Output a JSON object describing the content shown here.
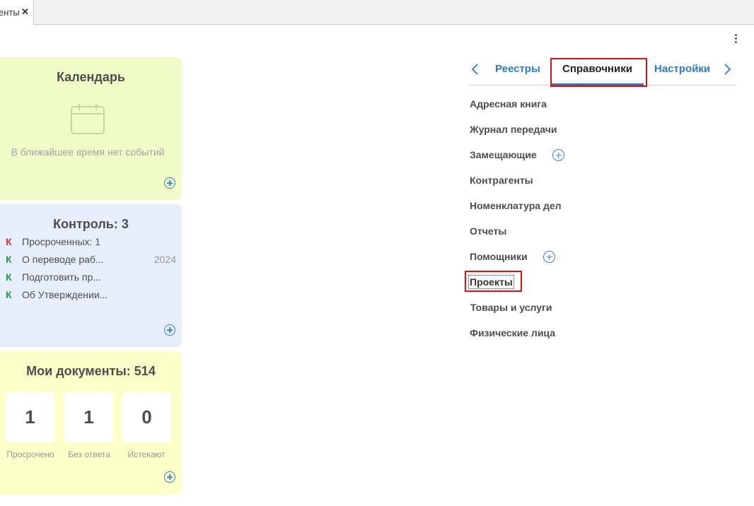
{
  "tabbar": {
    "doc_tab_label": "енты",
    "close_glyph": "✕"
  },
  "menu": {
    "icon": "kebab-menu-icon"
  },
  "calendar": {
    "title": "Календарь",
    "empty_text": "В ближайшее время нет событий",
    "icon": "calendar-icon"
  },
  "control": {
    "title": "Контроль: 3",
    "items": [
      {
        "marker": "К",
        "marker_color": "#d83a3a",
        "text": "Просроченных: 1",
        "date": ""
      },
      {
        "marker": "К",
        "marker_color": "#2a9e3f",
        "text": "О переводе раб...",
        "date": "2024"
      },
      {
        "marker": "К",
        "marker_color": "#2a9e3f",
        "text": "Подготовить пр...",
        "date": ""
      },
      {
        "marker": "К",
        "marker_color": "#2a9e3f",
        "text": "Об Утверждении...",
        "date": ""
      }
    ]
  },
  "my_docs": {
    "title": "Мои документы: 514",
    "counters": [
      {
        "value": "1",
        "label": "Просрочено"
      },
      {
        "value": "1",
        "label": "Без ответа"
      },
      {
        "value": "0",
        "label": "Истекают"
      }
    ]
  },
  "right_tabs": {
    "tabs": [
      {
        "label": "Реестры",
        "active": false
      },
      {
        "label": "Справочники",
        "active": true
      },
      {
        "label": "Настройки",
        "active": false
      }
    ],
    "prev_icon": "chevron-left-icon",
    "next_icon": "chevron-right-icon"
  },
  "references": {
    "items": [
      {
        "label": "Адресная книга",
        "has_add": false
      },
      {
        "label": "Журнал передачи",
        "has_add": false
      },
      {
        "label": "Замещающие",
        "has_add": true
      },
      {
        "label": "Контрагенты",
        "has_add": false
      },
      {
        "label": "Номенклатура дел",
        "has_add": false
      },
      {
        "label": "Отчеты",
        "has_add": false
      },
      {
        "label": "Помощники",
        "has_add": true
      },
      {
        "label": "Проекты",
        "has_add": false
      },
      {
        "label": "Товары и услуги",
        "has_add": false
      },
      {
        "label": "Физические лица",
        "has_add": false
      }
    ]
  },
  "colors": {
    "calendar_bg": "#f0fcc8",
    "control_bg": "#e6edfb",
    "docs_bg": "#fdfec8",
    "accent": "#2f7bc5",
    "highlight": "#e01010"
  }
}
